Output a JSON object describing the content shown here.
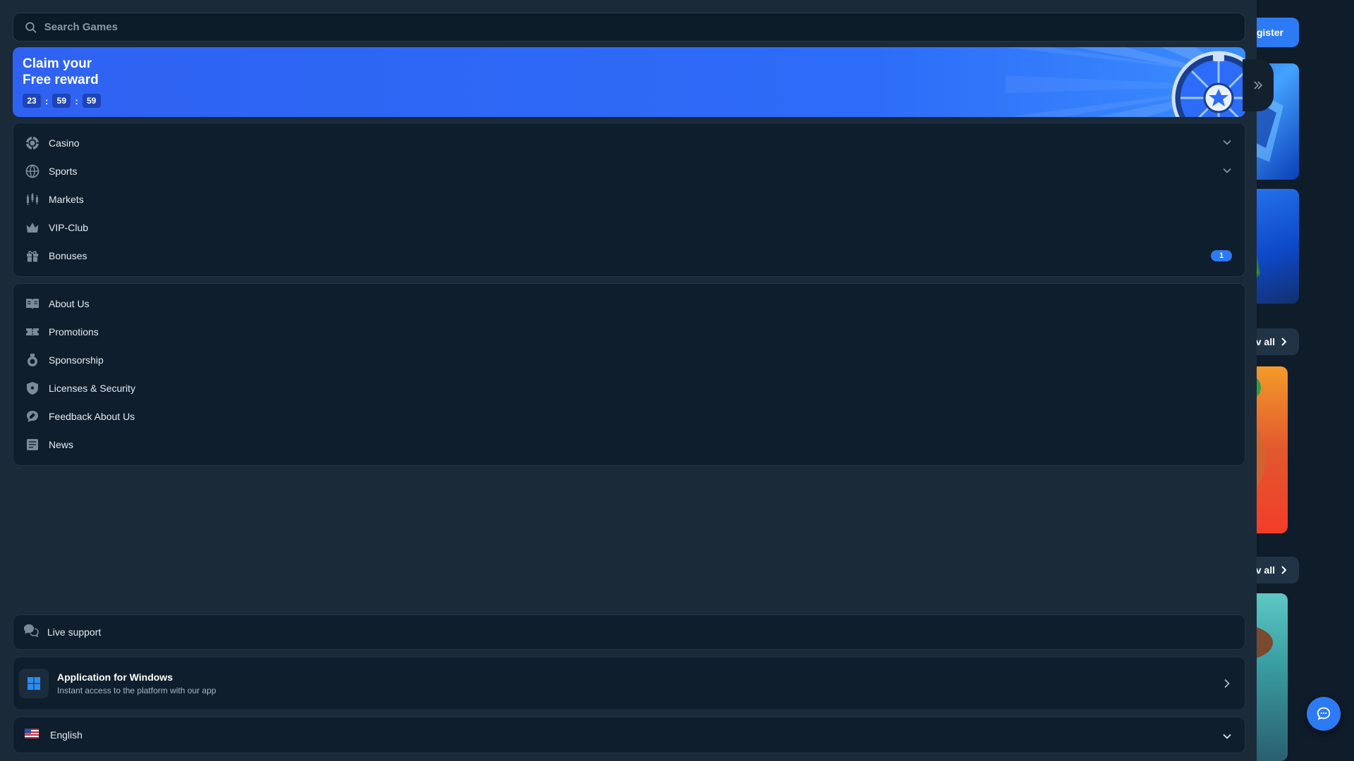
{
  "search": {
    "placeholder": "Search Games",
    "icon": "search-icon"
  },
  "banner": {
    "title_line1": "Claim your",
    "title_line2": "Free reward",
    "timer": {
      "hours": "23",
      "minutes": "59",
      "seconds": "59",
      "separator": ":"
    }
  },
  "nav_main": [
    {
      "label": "Casino",
      "icon": "casino-chip-icon",
      "expandable": true
    },
    {
      "label": "Sports",
      "icon": "globe-ball-icon",
      "expandable": true
    },
    {
      "label": "Markets",
      "icon": "candlestick-icon",
      "expandable": false
    },
    {
      "label": "VIP-Club",
      "icon": "crown-icon",
      "expandable": false
    },
    {
      "label": "Bonuses",
      "icon": "gift-icon",
      "expandable": false,
      "badge": "1"
    }
  ],
  "nav_info": [
    {
      "label": "About Us",
      "icon": "book-icon"
    },
    {
      "label": "Promotions",
      "icon": "ticket-icon"
    },
    {
      "label": "Sponsorship",
      "icon": "medal-icon"
    },
    {
      "label": "Licenses & Security",
      "icon": "shield-icon"
    },
    {
      "label": "Feedback About Us",
      "icon": "feedback-icon"
    },
    {
      "label": "News",
      "icon": "newspaper-icon"
    }
  ],
  "support": {
    "label": "Live support",
    "icon": "chat-bubbles-icon"
  },
  "windows_app": {
    "title": "Application for Windows",
    "subtitle": "Instant access to the platform with our app",
    "icon": "windows-icon"
  },
  "language": {
    "selected": "English",
    "flag": "us-flag-icon"
  },
  "background": {
    "register_label": "egister",
    "view_all_label": "v all"
  },
  "colors": {
    "accent": "#2d7bf4",
    "panel": "#1a2a38",
    "card": "#0e1e2d",
    "banner": "#2f62f2"
  }
}
